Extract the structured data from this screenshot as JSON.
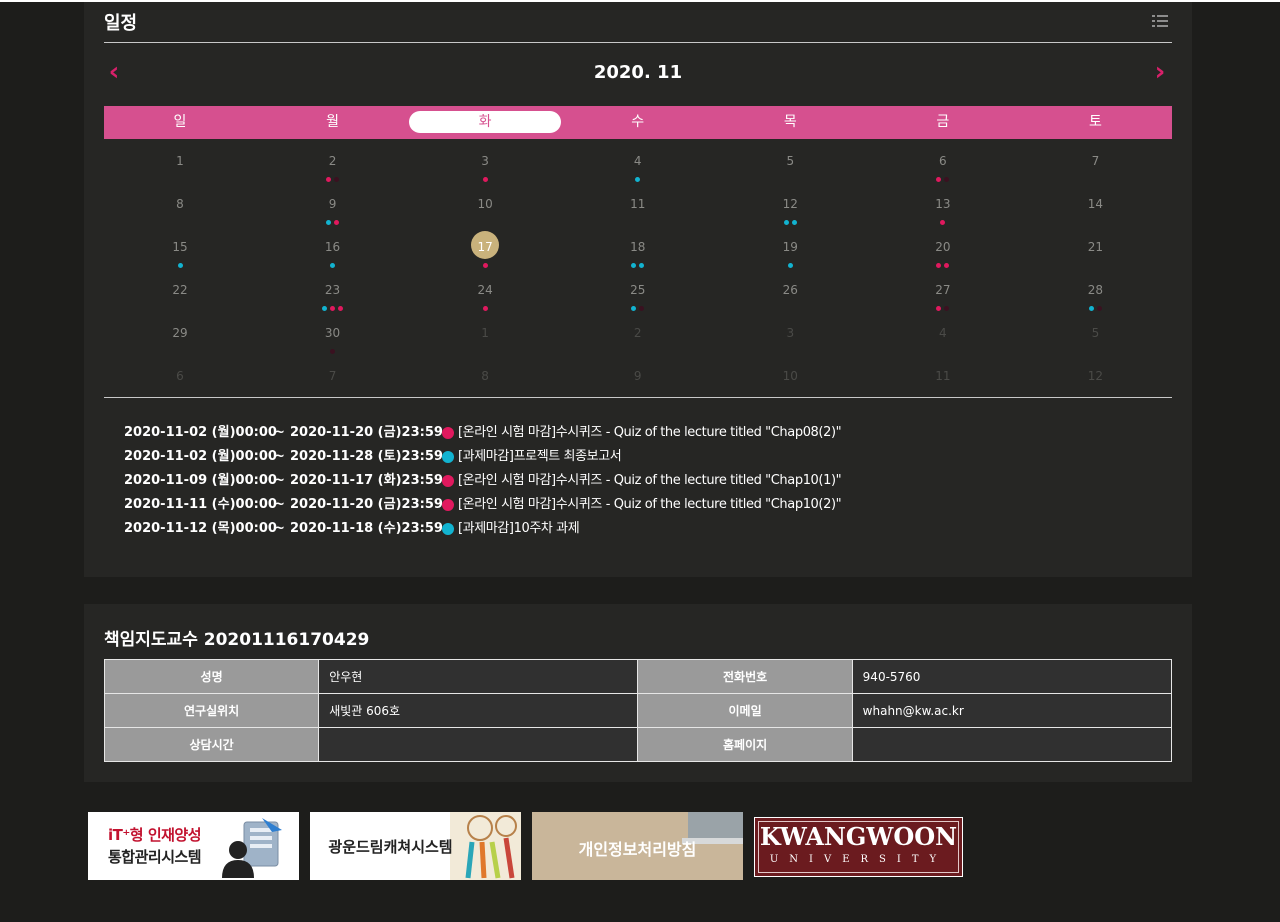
{
  "schedule": {
    "title": "일정",
    "month_label": "2020. 11",
    "prev_label": "‹",
    "next_label": "›",
    "weekdays": [
      "일",
      "월",
      "화",
      "수",
      "목",
      "금",
      "토"
    ],
    "active_weekday": 2,
    "weeks": [
      [
        {
          "d": "1"
        },
        {
          "d": "2",
          "dots": [
            "pink",
            "dark"
          ]
        },
        {
          "d": "3",
          "dots": [
            "pink"
          ]
        },
        {
          "d": "4",
          "dots": [
            "cyan"
          ]
        },
        {
          "d": "5"
        },
        {
          "d": "6",
          "dots": [
            "pink",
            "dark"
          ]
        },
        {
          "d": "7"
        }
      ],
      [
        {
          "d": "8"
        },
        {
          "d": "9",
          "dots": [
            "cyan",
            "pink"
          ]
        },
        {
          "d": "10"
        },
        {
          "d": "11"
        },
        {
          "d": "12",
          "dots": [
            "cyan",
            "cyan"
          ]
        },
        {
          "d": "13",
          "dots": [
            "pink"
          ]
        },
        {
          "d": "14"
        }
      ],
      [
        {
          "d": "15",
          "dots": [
            "cyan"
          ]
        },
        {
          "d": "16",
          "dots": [
            "cyan"
          ]
        },
        {
          "d": "17",
          "today": true,
          "dots": [
            "pink"
          ]
        },
        {
          "d": "18",
          "dots": [
            "cyan",
            "cyan"
          ]
        },
        {
          "d": "19",
          "dots": [
            "cyan"
          ]
        },
        {
          "d": "20",
          "dots": [
            "pink",
            "pink"
          ]
        },
        {
          "d": "21"
        }
      ],
      [
        {
          "d": "22"
        },
        {
          "d": "23",
          "dots": [
            "cyan",
            "pink",
            "pink"
          ]
        },
        {
          "d": "24",
          "dots": [
            "pink"
          ]
        },
        {
          "d": "25",
          "dots": [
            "cyan",
            "dark"
          ]
        },
        {
          "d": "26"
        },
        {
          "d": "27",
          "dots": [
            "pink",
            "dark"
          ]
        },
        {
          "d": "28",
          "dots": [
            "cyan",
            "dark"
          ]
        }
      ],
      [
        {
          "d": "29"
        },
        {
          "d": "30",
          "dots": [
            "dark"
          ]
        },
        {
          "d": "1",
          "other": true
        },
        {
          "d": "2",
          "other": true
        },
        {
          "d": "3",
          "other": true
        },
        {
          "d": "4",
          "other": true
        },
        {
          "d": "5",
          "other": true
        }
      ],
      [
        {
          "d": "6",
          "other": true
        },
        {
          "d": "7",
          "other": true
        },
        {
          "d": "8",
          "other": true
        },
        {
          "d": "9",
          "other": true
        },
        {
          "d": "10",
          "other": true
        },
        {
          "d": "11",
          "other": true
        },
        {
          "d": "12",
          "other": true
        }
      ]
    ],
    "events": [
      {
        "start": "2020-11-02 (월)00:00",
        "tilde": "~",
        "end": "2020-11-20 (금)23:59",
        "color": "pink",
        "title": "[온라인 시험 마감]수시퀴즈 - Quiz of the lecture titled \"Chap08(2)\""
      },
      {
        "start": "2020-11-02 (월)00:00",
        "tilde": "~",
        "end": "2020-11-28 (토)23:59",
        "color": "cyan",
        "title": "[과제마감]프로젝트 최종보고서"
      },
      {
        "start": "2020-11-09 (월)00:00",
        "tilde": "~",
        "end": "2020-11-17 (화)23:59",
        "color": "pink",
        "title": "[온라인 시험 마감]수시퀴즈 - Quiz of the lecture titled \"Chap10(1)\""
      },
      {
        "start": "2020-11-11 (수)00:00",
        "tilde": "~",
        "end": "2020-11-20 (금)23:59",
        "color": "pink",
        "title": "[온라인 시험 마감]수시퀴즈 - Quiz of the lecture titled \"Chap10(2)\""
      },
      {
        "start": "2020-11-12 (목)00:00",
        "tilde": "~",
        "end": "2020-11-18 (수)23:59",
        "color": "cyan",
        "title": "[과제마감]10주차 과제"
      }
    ]
  },
  "advisor": {
    "title": "책임지도교수 20201116170429",
    "rows": [
      {
        "l1": "성명",
        "v1": "안우현",
        "l2": "전화번호",
        "v2": "940-5760"
      },
      {
        "l1": "연구실위치",
        "v1": "새빛관 606호",
        "l2": "이메일",
        "v2": "whahn@kw.ac.kr"
      },
      {
        "l1": "상담시간",
        "v1": "",
        "l2": "홈페이지",
        "v2": ""
      }
    ]
  },
  "banners": {
    "it_line1": "iT⁺형 인재양성",
    "it_line2": "통합관리시스템",
    "dream": "광운드림캐쳐시스템",
    "privacy": "개인정보처리방침",
    "kw_name": "KWANGWOON",
    "kw_sub": "UNIVERSITY"
  },
  "colors": {
    "pink": "#e0195e",
    "cyan": "#12b3d0",
    "dark": "#3a1120",
    "accent": "#d6508f",
    "today": "#c9b27c"
  }
}
